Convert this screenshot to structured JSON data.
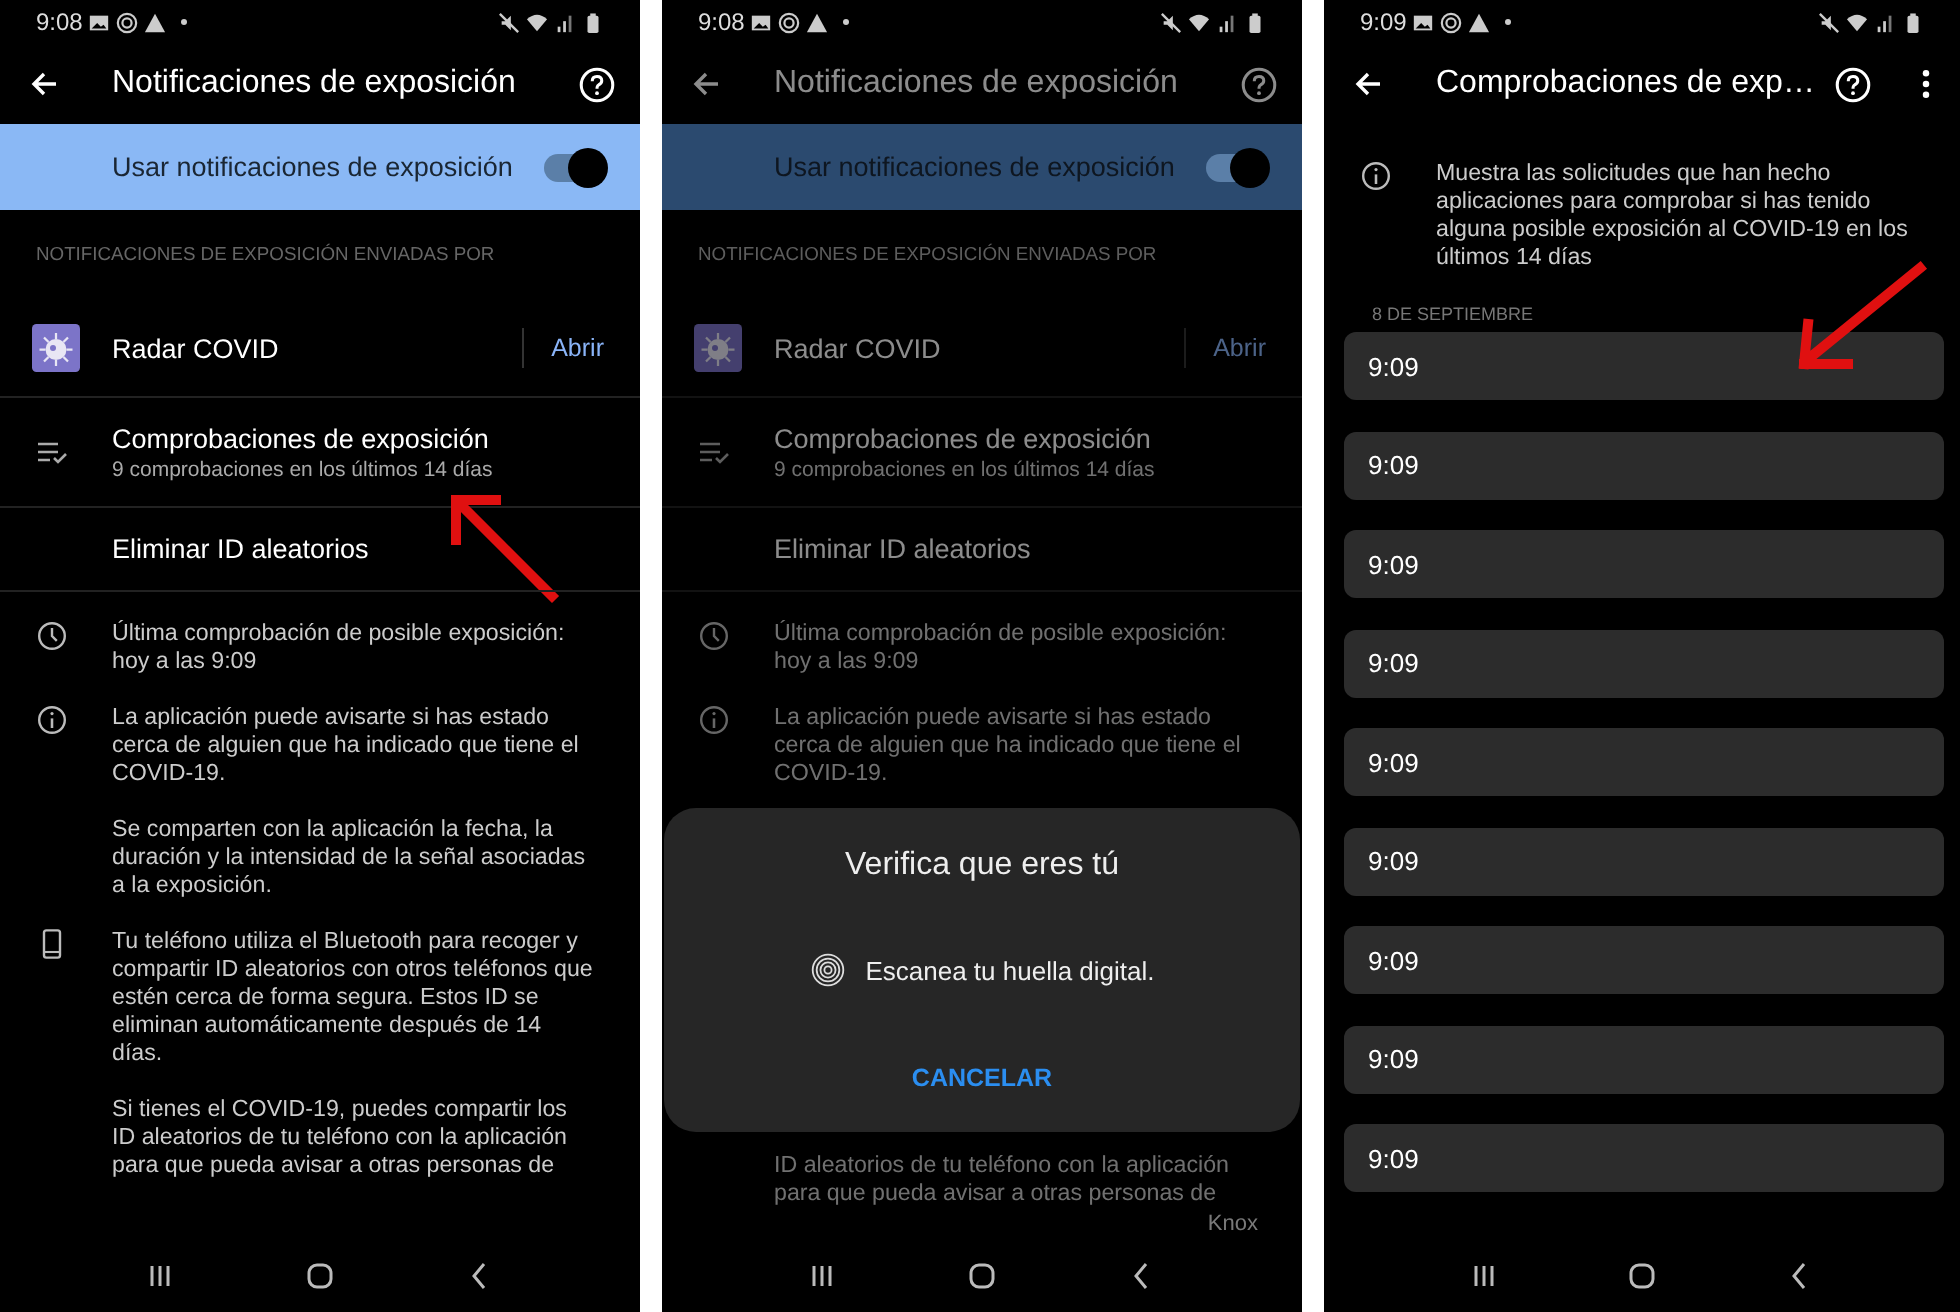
{
  "screens": [
    {
      "kind": "settings",
      "dimmed": false,
      "status_bar": {
        "time": "9:08"
      },
      "app_bar": {
        "title": "Notificaciones de exposición"
      },
      "master_switch": {
        "label": "Usar notificaciones de exposición",
        "on": true
      },
      "section_header": "NOTIFICACIONES DE EXPOSICIÓN ENVIADAS POR",
      "app": {
        "name": "Radar COVID",
        "action": "Abrir"
      },
      "rows": [
        {
          "title": "Comprobaciones de exposición",
          "subtitle": "9 comprobaciones en los últimos 14 días",
          "icon": true,
          "highlighted": true
        },
        {
          "title": "Eliminar ID aleatorios",
          "icon": false,
          "highlighted": false
        }
      ],
      "info": [
        {
          "kind": "clock",
          "paragraphs": [
            "Última comprobación de posible exposición: hoy a las 9:09"
          ]
        },
        {
          "kind": "info",
          "paragraphs": [
            "La aplicación puede avisarte si has estado cerca de alguien que ha indicado que tiene el COVID-19.",
            "Se comparten con la aplicación la fecha, la duración y la intensidad de la señal asociadas a la exposición."
          ]
        },
        {
          "kind": "phone",
          "paragraphs": [
            "Tu teléfono utiliza el Bluetooth para recoger y compartir ID aleatorios con otros teléfonos que estén cerca de forma segura. Estos ID se eliminan automáticamente después de 14 días.",
            "Si tienes el COVID-19, puedes compartir los ID aleatorios de tu teléfono con la aplicación para que pueda avisar a otras personas de"
          ]
        }
      ]
    },
    {
      "kind": "settings",
      "dimmed": true,
      "status_bar": {
        "time": "9:08"
      },
      "app_bar": {
        "title": "Notificaciones de exposición"
      },
      "master_switch": {
        "label": "Usar notificaciones de exposición",
        "on": true
      },
      "section_header": "NOTIFICACIONES DE EXPOSICIÓN ENVIADAS POR",
      "app": {
        "name": "Radar COVID",
        "action": "Abrir"
      },
      "rows": [
        {
          "title": "Comprobaciones de exposición",
          "subtitle": "9 comprobaciones en los últimos 14 días",
          "icon": true,
          "highlighted": false
        },
        {
          "title": "Eliminar ID aleatorios",
          "icon": false,
          "highlighted": false
        }
      ],
      "info": [
        {
          "kind": "clock",
          "paragraphs": [
            "Última comprobación de posible exposición: hoy a las 9:09"
          ]
        },
        {
          "kind": "info",
          "paragraphs": [
            "La aplicación puede avisarte si has estado cerca de alguien que ha indicado que tiene el COVID-19."
          ]
        }
      ],
      "dialog": {
        "title": "Verifica que eres tú",
        "message": "Escanea tu huella digital.",
        "button": "CANCELAR"
      },
      "trailing_text": "ID aleatorios de tu teléfono con la aplicación para que pueda avisar a otras personas de",
      "badge": "Knox"
    },
    {
      "kind": "checks",
      "dimmed": false,
      "status_bar": {
        "time": "9:09"
      },
      "app_bar": {
        "title": "Comprobaciones de exp…"
      },
      "info": "Muestra las solicitudes que han hecho aplicaciones para comprobar si has tenido alguna posible exposición al COVID-19 en los últimos 14 días",
      "date_header": "8 DE SEPTIEMBRE",
      "checks": [
        {
          "time": "9:09",
          "highlighted": true
        },
        {
          "time": "9:09",
          "highlighted": false
        },
        {
          "time": "9:09",
          "highlighted": false
        },
        {
          "time": "9:09",
          "highlighted": false
        },
        {
          "time": "9:09",
          "highlighted": false
        },
        {
          "time": "9:09",
          "highlighted": false
        },
        {
          "time": "9:09",
          "highlighted": false
        },
        {
          "time": "9:09",
          "highlighted": false
        },
        {
          "time": "9:09",
          "highlighted": false
        }
      ]
    }
  ]
}
